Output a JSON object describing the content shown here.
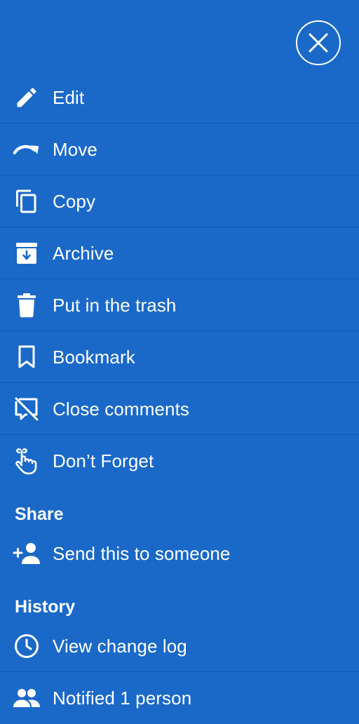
{
  "close_button": {
    "icon": "close-icon"
  },
  "menu": {
    "items": [
      {
        "label": "Edit",
        "icon": "pencil-icon"
      },
      {
        "label": "Move",
        "icon": "move-arrow-icon"
      },
      {
        "label": "Copy",
        "icon": "copy-icon"
      },
      {
        "label": "Archive",
        "icon": "archive-icon"
      },
      {
        "label": "Put in the trash",
        "icon": "trash-icon"
      },
      {
        "label": "Bookmark",
        "icon": "bookmark-icon"
      },
      {
        "label": "Close comments",
        "icon": "comments-off-icon"
      },
      {
        "label": "Don’t Forget",
        "icon": "finger-ribbon-icon"
      }
    ]
  },
  "share": {
    "heading": "Share",
    "items": [
      {
        "label": "Send this to someone",
        "icon": "person-add-icon"
      }
    ]
  },
  "history": {
    "heading": "History",
    "items": [
      {
        "label": "View change log",
        "icon": "clock-icon"
      },
      {
        "label": "Notified 1 person",
        "icon": "people-icon"
      }
    ]
  },
  "colors": {
    "background": "#1a69c9",
    "divider": "#1457ad",
    "foreground": "#ffffff"
  }
}
